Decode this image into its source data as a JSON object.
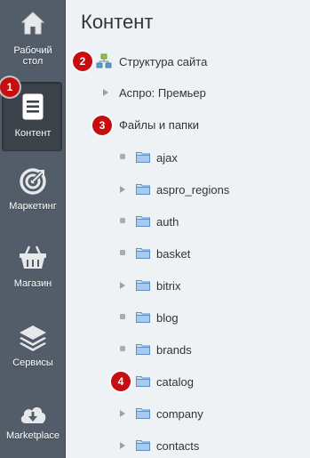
{
  "sidebar": {
    "items": [
      {
        "label_line1": "Рабочий",
        "label_line2": "стол",
        "icon": "home-icon"
      },
      {
        "label": "Контент",
        "icon": "document-icon",
        "active": true
      },
      {
        "label": "Маркетинг",
        "icon": "target-icon"
      },
      {
        "label": "Магазин",
        "icon": "basket-icon"
      },
      {
        "label": "Сервисы",
        "icon": "layers-icon"
      },
      {
        "label": "Marketplace",
        "icon": "cloud-download-icon"
      }
    ]
  },
  "main": {
    "title": "Контент",
    "tree": {
      "root": "Структура сайта",
      "items": [
        "Аспро: Премьер",
        "Файлы и папки"
      ],
      "folders": [
        "ajax",
        "aspro_regions",
        "auth",
        "basket",
        "bitrix",
        "blog",
        "brands",
        "catalog",
        "company",
        "contacts"
      ]
    }
  },
  "badges": [
    "1",
    "2",
    "3",
    "4"
  ],
  "colors": {
    "sidebar_bg": "#535c69",
    "badge_red": "#c70d10",
    "folder_blue": "#5b9bd5"
  }
}
